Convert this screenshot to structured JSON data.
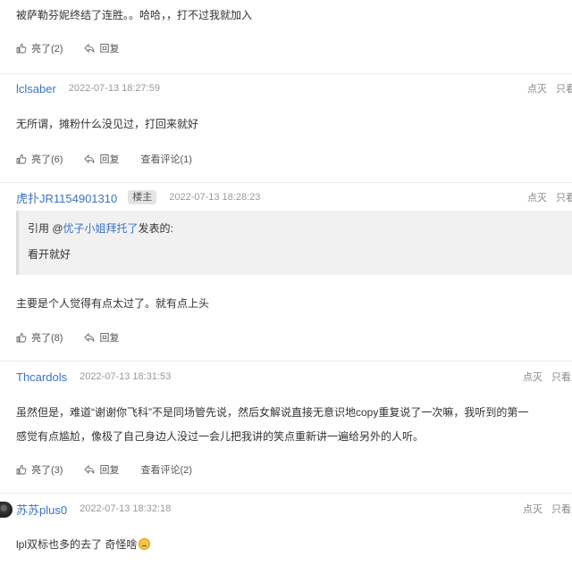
{
  "comments": [
    {
      "text": "被萨勒芬妮终结了连胜。。哈哈，，打不过我就加入",
      "like_label": "亮了(2)",
      "reply_label": "回复"
    },
    {
      "username": "lclsaber",
      "time": "2022-07-13 18:27:59",
      "ops": [
        "点灭",
        "只看"
      ],
      "text": "无所谓，摊粉什么没见过，打回来就好",
      "like_label": "亮了(6)",
      "reply_label": "回复",
      "view_comments_label": "查看评论(1)"
    },
    {
      "username": "虎扑JR1154901310",
      "badge": "楼主",
      "time": "2022-07-13 18:28:23",
      "ops": [
        "点灭",
        "只看"
      ],
      "quote": {
        "prefix": "引用 @",
        "name": "优子小姐拜托了",
        "suffix": "发表的:",
        "body": "看开就好"
      },
      "text": "主要是个人觉得有点太过了。就有点上头",
      "like_label": "亮了(8)",
      "reply_label": "回复"
    },
    {
      "username": "Thcardols",
      "time": "2022-07-13 18:31:53",
      "ops": [
        "点灭",
        "只看此"
      ],
      "text_lines": [
        "虽然但是，难道“谢谢你飞科”不是同场管先说，然后女解说直接无意识地copy重复说了一次嘛，我听到的第一",
        "感觉有点尴尬，像极了自己身边人没过一会儿把我讲的笑点重新讲一遍给另外的人听。"
      ],
      "like_label": "亮了(3)",
      "reply_label": "回复",
      "view_comments_label": "查看评论(2)"
    },
    {
      "username": "苏苏plus0",
      "time": "2022-07-13 18:32:18",
      "ops": [
        "点灭",
        "只看此"
      ],
      "text": "lpl双标也多的去了 奇怪啥"
    }
  ],
  "colors": {
    "username": "#3b73c6",
    "meta": "#999999",
    "quote_bg": "#f1f1f1"
  }
}
